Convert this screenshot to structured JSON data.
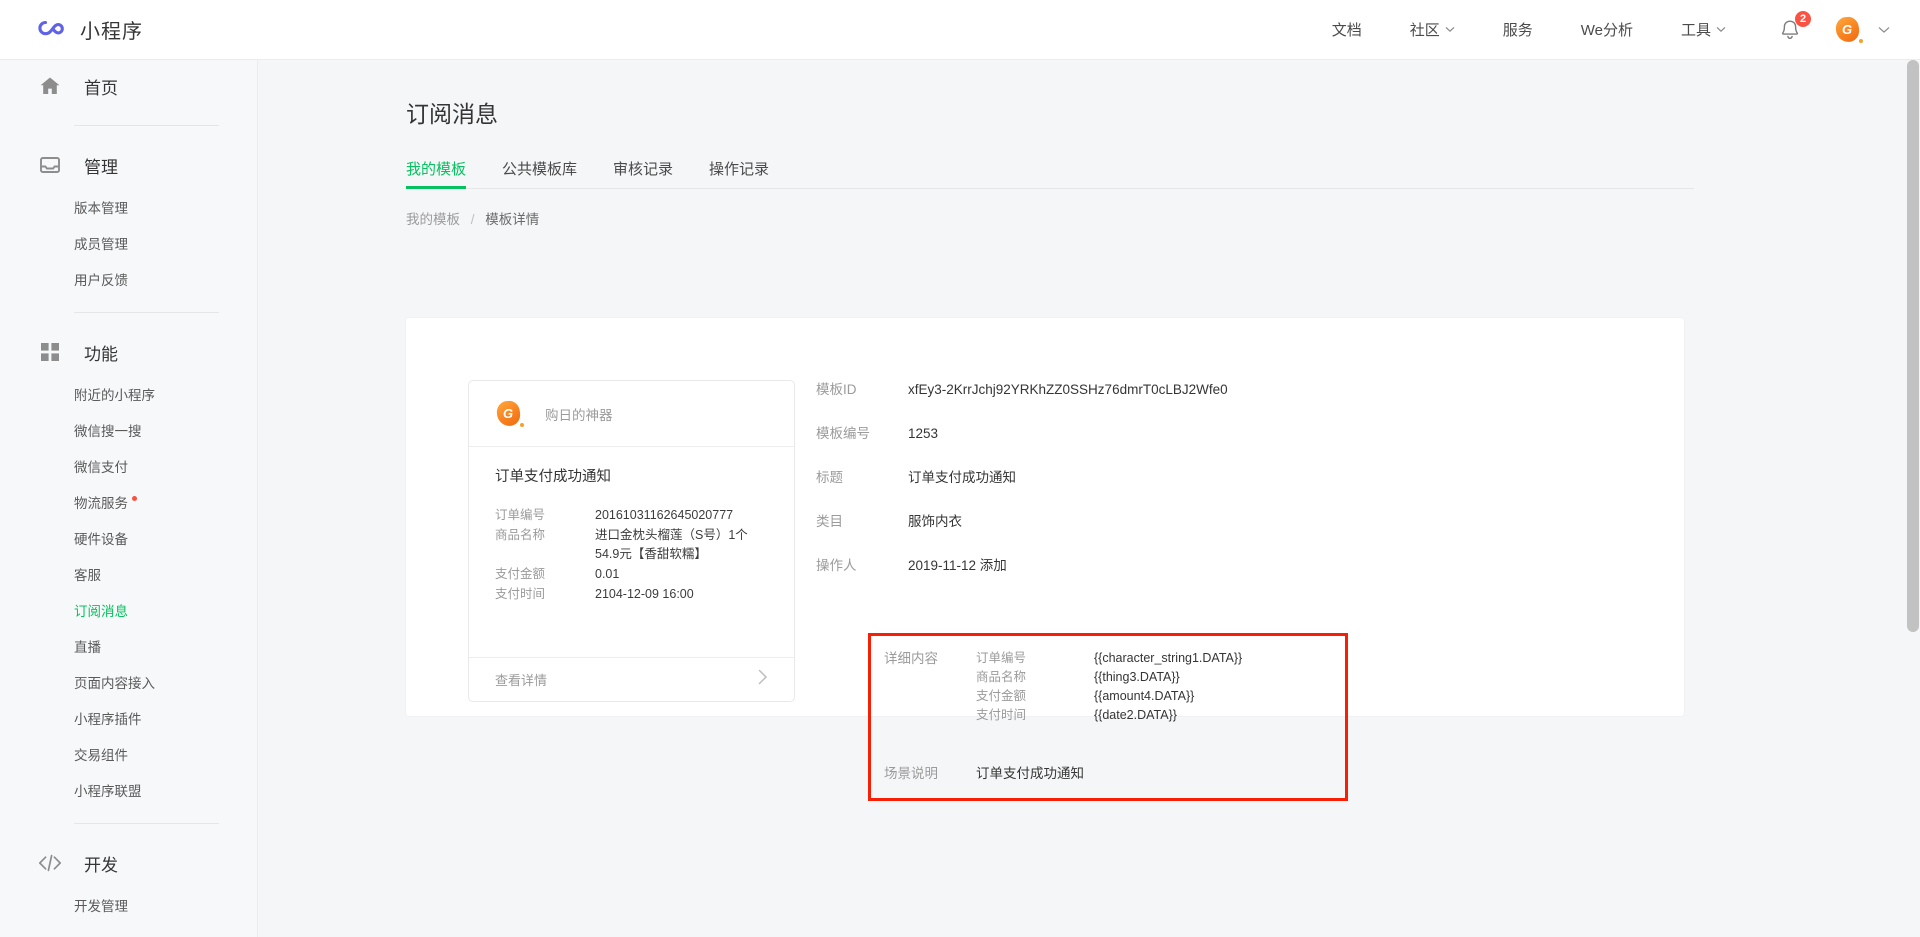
{
  "header": {
    "brand": "小程序",
    "logo_icon": "miniprogram-logo-icon",
    "nav": [
      {
        "label": "文档",
        "has_caret": false
      },
      {
        "label": "社区",
        "has_caret": true
      },
      {
        "label": "服务",
        "has_caret": false
      },
      {
        "label": "We分析",
        "has_caret": false
      },
      {
        "label": "工具",
        "has_caret": true
      }
    ],
    "bell_icon": "bell-icon",
    "notification_count": "2",
    "avatar_letter": "G",
    "account_caret_icon": "chevron-down-icon"
  },
  "sidebar": {
    "groups": [
      {
        "icon": "home-icon",
        "label": "首页",
        "items": []
      },
      {
        "icon": "inbox-icon",
        "label": "管理",
        "items": [
          {
            "label": "版本管理",
            "active": false,
            "dot": false
          },
          {
            "label": "成员管理",
            "active": false,
            "dot": false
          },
          {
            "label": "用户反馈",
            "active": false,
            "dot": false
          }
        ]
      },
      {
        "icon": "grid-icon",
        "label": "功能",
        "items": [
          {
            "label": "附近的小程序",
            "active": false,
            "dot": false
          },
          {
            "label": "微信搜一搜",
            "active": false,
            "dot": false
          },
          {
            "label": "微信支付",
            "active": false,
            "dot": false
          },
          {
            "label": "物流服务",
            "active": false,
            "dot": true
          },
          {
            "label": "硬件设备",
            "active": false,
            "dot": false
          },
          {
            "label": "客服",
            "active": false,
            "dot": false
          },
          {
            "label": "订阅消息",
            "active": true,
            "dot": false
          },
          {
            "label": "直播",
            "active": false,
            "dot": false
          },
          {
            "label": "页面内容接入",
            "active": false,
            "dot": false
          },
          {
            "label": "小程序插件",
            "active": false,
            "dot": false
          },
          {
            "label": "交易组件",
            "active": false,
            "dot": false
          },
          {
            "label": "小程序联盟",
            "active": false,
            "dot": false
          }
        ]
      },
      {
        "icon": "code-icon",
        "label": "开发",
        "items": [
          {
            "label": "开发管理",
            "active": false,
            "dot": false
          }
        ]
      }
    ]
  },
  "page": {
    "title": "订阅消息",
    "tabs": [
      {
        "label": "我的模板",
        "active": true
      },
      {
        "label": "公共模板库",
        "active": false
      },
      {
        "label": "审核记录",
        "active": false
      },
      {
        "label": "操作记录",
        "active": false
      }
    ],
    "breadcrumb": {
      "parent": "我的模板",
      "separator": "/",
      "current": "模板详情"
    }
  },
  "preview": {
    "app_name": "购日的神器",
    "avatar_letter": "G",
    "notice_title": "订单支付成功通知",
    "fields": [
      {
        "key": "订单编号",
        "value": "20161031162645020777"
      },
      {
        "key": "商品名称",
        "value": "进口金枕头榴莲（S号）1个54.9元【香甜软糯】"
      },
      {
        "key": "支付金额",
        "value": "0.01"
      },
      {
        "key": "支付时间",
        "value": "2104-12-09 16:00"
      }
    ],
    "footer_label": "查看详情",
    "footer_icon": "chevron-right-icon"
  },
  "detail": {
    "rows": [
      {
        "key": "模板ID",
        "value": "xfEy3-2KrrJchj92YRKhZZ0SSHz76dmrT0cLBJ2Wfe0"
      },
      {
        "key": "模板编号",
        "value": "1253"
      },
      {
        "key": "标题",
        "value": "订单支付成功通知"
      },
      {
        "key": "类目",
        "value": "服饰内衣"
      },
      {
        "key": "操作人",
        "value": "2019-11-12 添加"
      }
    ],
    "content_key": "详细内容",
    "content_rows": [
      {
        "key": "订单编号",
        "value": "{{character_string1.DATA}}"
      },
      {
        "key": "商品名称",
        "value": "{{thing3.DATA}}"
      },
      {
        "key": "支付金额",
        "value": "{{amount4.DATA}}"
      },
      {
        "key": "支付时间",
        "value": "{{date2.DATA}}"
      }
    ],
    "scene_key": "场景说明",
    "scene_value": "订单支付成功通知"
  },
  "colors": {
    "accent_green": "#07c160",
    "brand_purple": "#6063e8",
    "badge_red": "#fa5343",
    "highlight_red": "#f81f07",
    "avatar_orange": "#f7801e"
  }
}
